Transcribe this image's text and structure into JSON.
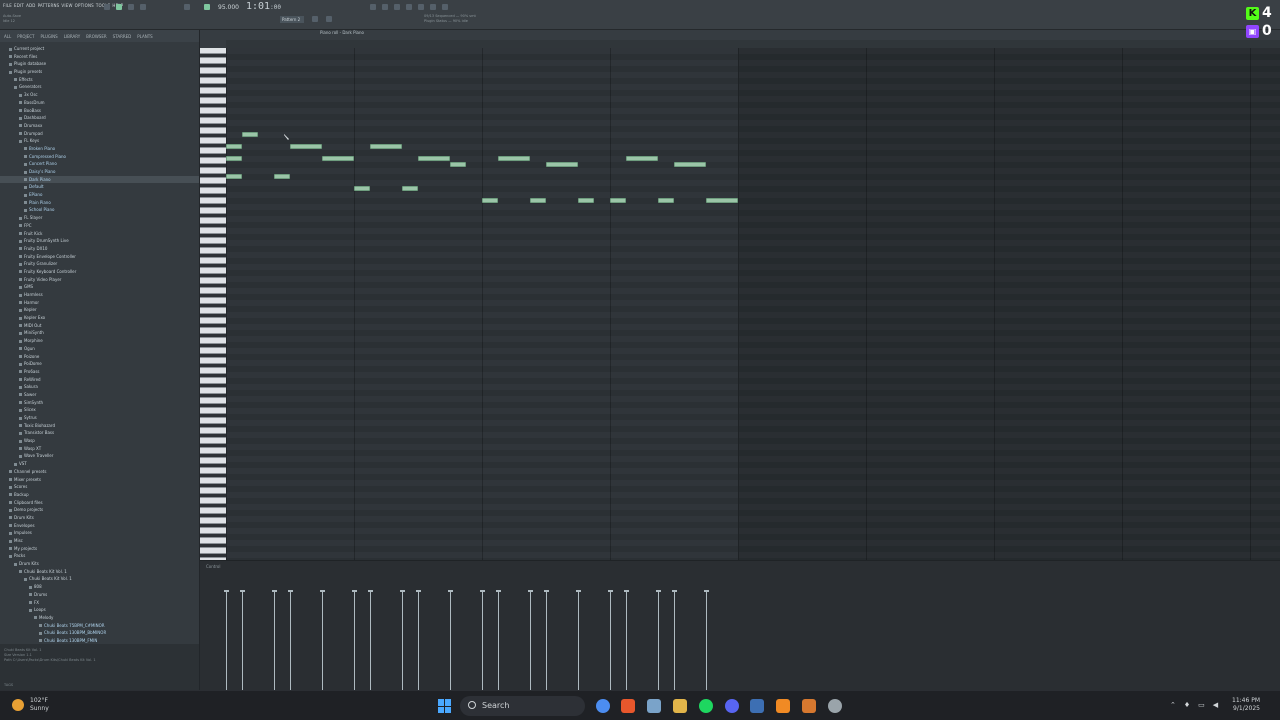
{
  "toolbar": {
    "menu": [
      "FILE",
      "EDIT",
      "ADD",
      "PATTERNS",
      "VIEW",
      "OPTIONS",
      "TOOLS",
      "HELP"
    ],
    "hint_line1": "Auto-Save",
    "hint_line2": "Idle 12",
    "time": "1:01",
    "time_sub": ":00",
    "tempo": "95.000",
    "pattern": "Pattern 2",
    "cpu_line1": "09/13  Sequenced — 90% smt",
    "cpu_line2": "Plugin Status — 90% idle"
  },
  "browser": {
    "tabs": [
      "ALL",
      "PROJECT",
      "PLUGINS",
      "LIBRARY",
      "BROWSER",
      "STARRED",
      "PLANTS"
    ],
    "tree": [
      {
        "label": "Current project",
        "indent": 1,
        "type": "folder"
      },
      {
        "label": "Recent files",
        "indent": 1,
        "type": "folder"
      },
      {
        "label": "Plugin database",
        "indent": 1,
        "type": "folder"
      },
      {
        "label": "Plugin presets",
        "indent": 1,
        "type": "folder"
      },
      {
        "label": "Effects",
        "indent": 2,
        "type": "folder"
      },
      {
        "label": "Generators",
        "indent": 2,
        "type": "folder"
      },
      {
        "label": "3x Osc",
        "indent": 3,
        "type": "folder"
      },
      {
        "label": "BassDrum",
        "indent": 3,
        "type": "folder"
      },
      {
        "label": "BooBass",
        "indent": 3,
        "type": "folder"
      },
      {
        "label": "Dashboard",
        "indent": 3,
        "type": "folder"
      },
      {
        "label": "Drumaxx",
        "indent": 3,
        "type": "folder"
      },
      {
        "label": "Drumpad",
        "indent": 3,
        "type": "folder"
      },
      {
        "label": "FL Keys",
        "indent": 3,
        "type": "folder"
      },
      {
        "label": "Broken Piano",
        "indent": 4,
        "type": "file"
      },
      {
        "label": "Compressed Piano",
        "indent": 4,
        "type": "file"
      },
      {
        "label": "Concert Piano",
        "indent": 4,
        "type": "file"
      },
      {
        "label": "Daisy's Piano",
        "indent": 4,
        "type": "file"
      },
      {
        "label": "Dark Piano",
        "indent": 4,
        "type": "file",
        "selected": true
      },
      {
        "label": "Default",
        "indent": 4,
        "type": "file"
      },
      {
        "label": "EPiano",
        "indent": 4,
        "type": "file"
      },
      {
        "label": "Plain Piano",
        "indent": 4,
        "type": "file"
      },
      {
        "label": "School Piano",
        "indent": 4,
        "type": "file"
      },
      {
        "label": "FL Slayer",
        "indent": 3,
        "type": "folder"
      },
      {
        "label": "FPC",
        "indent": 3,
        "type": "folder"
      },
      {
        "label": "Fruit Kick",
        "indent": 3,
        "type": "folder"
      },
      {
        "label": "Fruity DrumSynth Live",
        "indent": 3,
        "type": "folder"
      },
      {
        "label": "Fruity DX10",
        "indent": 3,
        "type": "folder"
      },
      {
        "label": "Fruity Envelope Controller",
        "indent": 3,
        "type": "folder"
      },
      {
        "label": "Fruity Granulizer",
        "indent": 3,
        "type": "folder"
      },
      {
        "label": "Fruity Keyboard Controller",
        "indent": 3,
        "type": "folder"
      },
      {
        "label": "Fruity Video Player",
        "indent": 3,
        "type": "folder"
      },
      {
        "label": "GMS",
        "indent": 3,
        "type": "folder"
      },
      {
        "label": "Harmless",
        "indent": 3,
        "type": "folder"
      },
      {
        "label": "Harmor",
        "indent": 3,
        "type": "folder"
      },
      {
        "label": "Kepler",
        "indent": 3,
        "type": "folder"
      },
      {
        "label": "Kepler Exo",
        "indent": 3,
        "type": "folder"
      },
      {
        "label": "MIDI Out",
        "indent": 3,
        "type": "folder"
      },
      {
        "label": "MiniSynth",
        "indent": 3,
        "type": "folder"
      },
      {
        "label": "Morphine",
        "indent": 3,
        "type": "folder"
      },
      {
        "label": "Ogun",
        "indent": 3,
        "type": "folder"
      },
      {
        "label": "Poizone",
        "indent": 3,
        "type": "folder"
      },
      {
        "label": "PoiDome",
        "indent": 3,
        "type": "folder"
      },
      {
        "label": "Pro6ass",
        "indent": 3,
        "type": "folder"
      },
      {
        "label": "ReWired",
        "indent": 3,
        "type": "folder"
      },
      {
        "label": "Sakura",
        "indent": 3,
        "type": "folder"
      },
      {
        "label": "Sawer",
        "indent": 3,
        "type": "folder"
      },
      {
        "label": "SimSynth",
        "indent": 3,
        "type": "folder"
      },
      {
        "label": "Slicex",
        "indent": 3,
        "type": "folder"
      },
      {
        "label": "Sytrus",
        "indent": 3,
        "type": "folder"
      },
      {
        "label": "Toxic Biohazard",
        "indent": 3,
        "type": "folder"
      },
      {
        "label": "Transistor Bass",
        "indent": 3,
        "type": "folder"
      },
      {
        "label": "Wasp",
        "indent": 3,
        "type": "folder"
      },
      {
        "label": "Wasp XT",
        "indent": 3,
        "type": "folder"
      },
      {
        "label": "Wave Traveller",
        "indent": 3,
        "type": "folder"
      },
      {
        "label": "VST",
        "indent": 2,
        "type": "folder"
      },
      {
        "label": "Channel presets",
        "indent": 1,
        "type": "folder"
      },
      {
        "label": "Mixer presets",
        "indent": 1,
        "type": "folder"
      },
      {
        "label": "Scores",
        "indent": 1,
        "type": "folder"
      },
      {
        "label": "Backup",
        "indent": 1,
        "type": "folder"
      },
      {
        "label": "Clipboard files",
        "indent": 1,
        "type": "folder"
      },
      {
        "label": "Demo projects",
        "indent": 1,
        "type": "folder"
      },
      {
        "label": "Drum Kits",
        "indent": 1,
        "type": "folder"
      },
      {
        "label": "Envelopes",
        "indent": 1,
        "type": "folder"
      },
      {
        "label": "Impulses",
        "indent": 1,
        "type": "folder"
      },
      {
        "label": "Misc",
        "indent": 1,
        "type": "folder"
      },
      {
        "label": "My projects",
        "indent": 1,
        "type": "folder"
      },
      {
        "label": "Packs",
        "indent": 1,
        "type": "folder"
      },
      {
        "label": "Drum Kits",
        "indent": 2,
        "type": "folder"
      },
      {
        "label": "Chuki Beats Kit Vol. 1",
        "indent": 3,
        "type": "folder"
      },
      {
        "label": "Chuki Beats Kit Vol. 1",
        "indent": 4,
        "type": "folder"
      },
      {
        "label": "808",
        "indent": 5,
        "type": "folder"
      },
      {
        "label": "Drums",
        "indent": 5,
        "type": "folder"
      },
      {
        "label": "FX",
        "indent": 5,
        "type": "folder"
      },
      {
        "label": "Loops",
        "indent": 5,
        "type": "folder"
      },
      {
        "label": "Melody",
        "indent": 6,
        "type": "folder"
      },
      {
        "label": "Chuki Beats 75BPM_C#MINOR",
        "indent": 7,
        "type": "file"
      },
      {
        "label": "Chuki Beats 130BPM_BbMINOR",
        "indent": 7,
        "type": "file"
      },
      {
        "label": "Chuki Beats 130BPM_FMIN",
        "indent": 7,
        "type": "file"
      }
    ],
    "footer_line1": "Chuki Beats Kit Vol. 1",
    "footer_line2": "Size   Version 1.1",
    "footer_line3": "Path   C:\\Users\\Packs\\Drum Kits\\Chuki Beats Kit Vol. 1",
    "search_label": "TAGS"
  },
  "piano_roll": {
    "title": "Piano roll - Dark Piano",
    "control_label": "Control",
    "bars_total": 8,
    "bars_with_notes": 4,
    "notes": [
      {
        "start": 0.0,
        "length": 0.125,
        "row": 16
      },
      {
        "start": 0.0,
        "length": 0.125,
        "row": 18
      },
      {
        "start": 0.0,
        "length": 0.125,
        "row": 21
      },
      {
        "start": 0.125,
        "length": 0.125,
        "row": 14
      },
      {
        "start": 0.375,
        "length": 0.125,
        "row": 21
      },
      {
        "start": 0.5,
        "length": 0.25,
        "row": 16
      },
      {
        "start": 0.75,
        "length": 0.25,
        "row": 18
      },
      {
        "start": 1.0,
        "length": 0.125,
        "row": 23
      },
      {
        "start": 1.125,
        "length": 0.25,
        "row": 16
      },
      {
        "start": 1.375,
        "length": 0.125,
        "row": 23
      },
      {
        "start": 1.5,
        "length": 0.25,
        "row": 18
      },
      {
        "start": 1.75,
        "length": 0.125,
        "row": 19
      },
      {
        "start": 2.0,
        "length": 0.125,
        "row": 25
      },
      {
        "start": 2.125,
        "length": 0.25,
        "row": 18
      },
      {
        "start": 2.375,
        "length": 0.125,
        "row": 25
      },
      {
        "start": 2.5,
        "length": 0.25,
        "row": 19
      },
      {
        "start": 2.75,
        "length": 0.125,
        "row": 25
      },
      {
        "start": 3.0,
        "length": 0.125,
        "row": 25
      },
      {
        "start": 3.125,
        "length": 0.25,
        "row": 18
      },
      {
        "start": 3.375,
        "length": 0.125,
        "row": 25
      },
      {
        "start": 3.5,
        "length": 0.25,
        "row": 19
      },
      {
        "start": 3.75,
        "length": 0.25,
        "row": 25
      }
    ],
    "velocity_notes": [
      0.0,
      0.125,
      0.375,
      0.5,
      0.75,
      1.0,
      1.125,
      1.375,
      1.5,
      1.75,
      2.0,
      2.125,
      2.375,
      2.5,
      2.75,
      3.0,
      3.125,
      3.375,
      3.5,
      3.75
    ],
    "note_color": "#9bc5a8"
  },
  "overlay": {
    "k_count": "4",
    "t_count": "0",
    "k_color": "#53fc18",
    "t_color": "#9146ff"
  },
  "taskbar": {
    "temperature": "102°F",
    "condition": "Sunny",
    "search_placeholder": "Search",
    "time": "11:46 PM",
    "date": "9/1/2025",
    "accent": "#4aa8ff"
  }
}
